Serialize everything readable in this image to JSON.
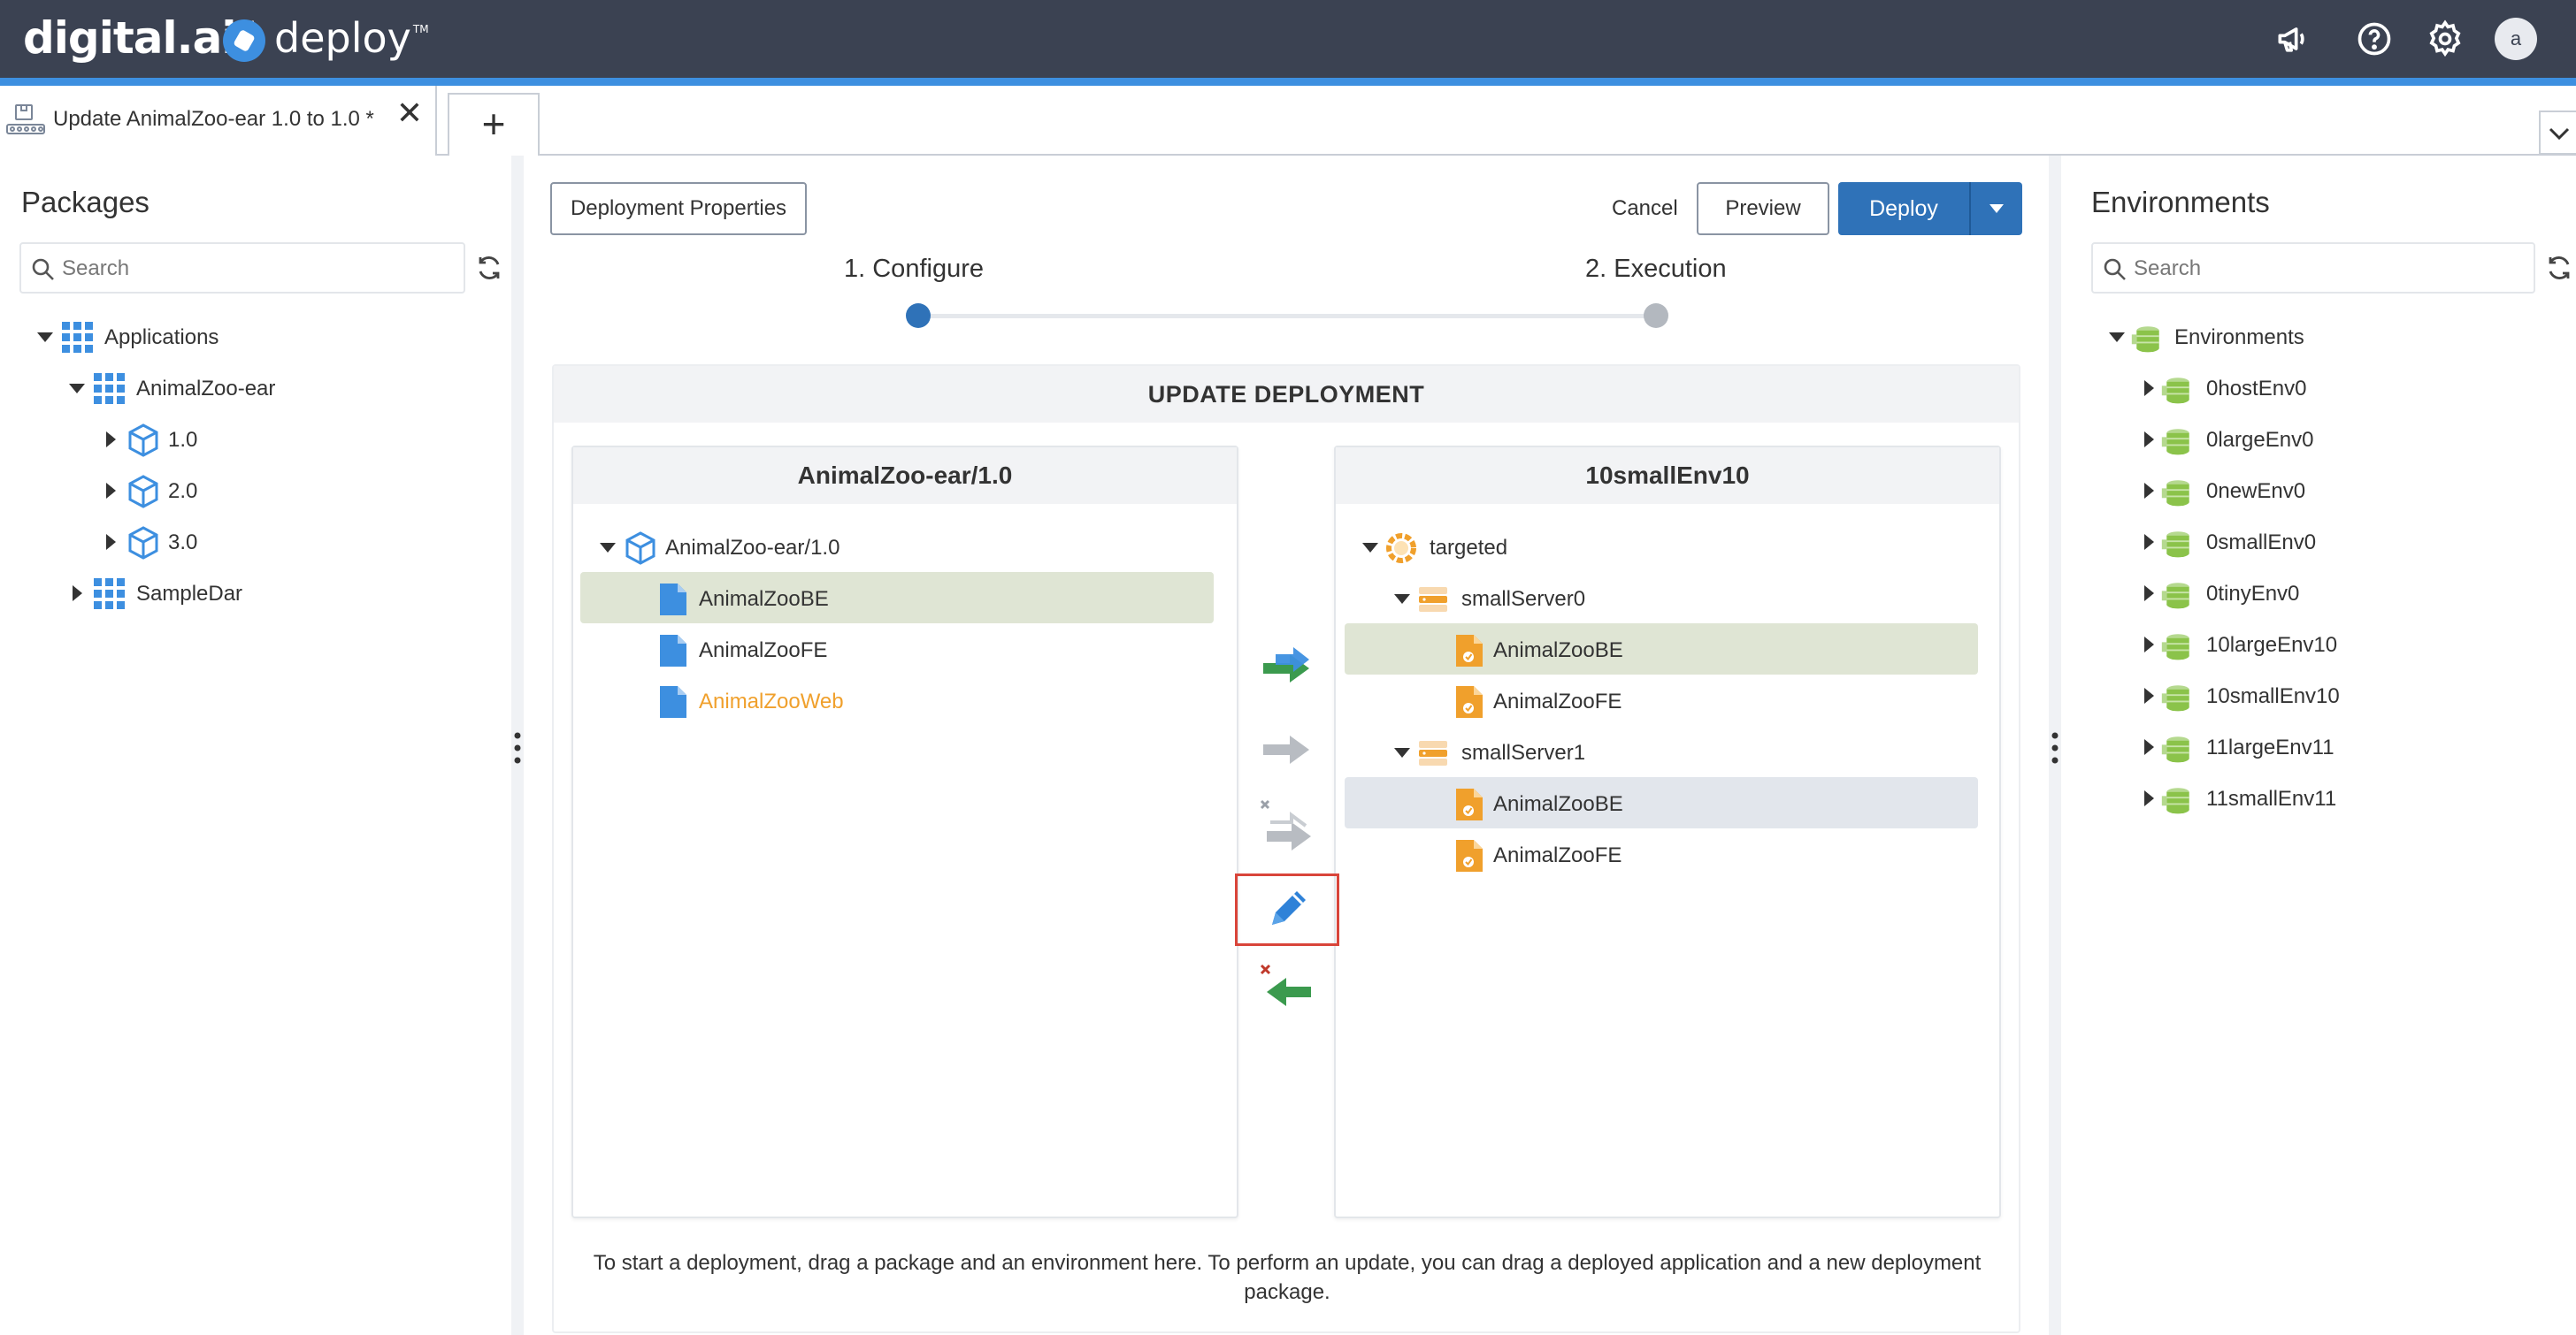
{
  "header": {
    "brand": "digital.ai",
    "brand_mark": "TM",
    "product": "deploy",
    "product_mark": "TM",
    "icons": [
      "megaphone-icon",
      "help-icon",
      "settings-icon"
    ],
    "avatar_initial": "a"
  },
  "tabs": {
    "active_title": "Update AnimalZoo-ear 1.0 to 1.0 *",
    "close_glyph": "✕",
    "add_glyph": "+"
  },
  "packages": {
    "title": "Packages",
    "search_placeholder": "Search",
    "tree": {
      "applications": "Applications",
      "app": "AnimalZoo-ear",
      "versions": [
        "1.0",
        "2.0",
        "3.0"
      ],
      "other": "SampleDar"
    }
  },
  "toolbar": {
    "properties": "Deployment Properties",
    "cancel": "Cancel",
    "preview": "Preview",
    "deploy": "Deploy"
  },
  "steps": {
    "configure": "1. Configure",
    "execution": "2. Execution",
    "active_color": "#2f72b8",
    "inactive_color": "#b3b8bf"
  },
  "deployment": {
    "title": "UPDATE DEPLOYMENT",
    "package_panel": {
      "title": "AnimalZoo-ear/1.0",
      "root": "AnimalZoo-ear/1.0",
      "items": [
        "AnimalZooBE",
        "AnimalZooFE",
        "AnimalZooWeb"
      ]
    },
    "environment_panel": {
      "title": "10smallEnv10",
      "root": "targeted",
      "servers": [
        {
          "name": "smallServer0",
          "items": [
            "AnimalZooBE",
            "AnimalZooFE"
          ]
        },
        {
          "name": "smallServer1",
          "items": [
            "AnimalZooBE",
            "AnimalZooFE"
          ]
        }
      ]
    },
    "actions": [
      "map-selected-icon",
      "map-all-icon",
      "unmap-all-icon",
      "edit-icon",
      "remove-icon"
    ],
    "hint": "To start a deployment, drag a package and an environment here. To perform an update, you can drag a deployed application and a new deployment package."
  },
  "environments": {
    "title": "Environments",
    "search_placeholder": "Search",
    "root": "Environments",
    "items": [
      "0hostEnv0",
      "0largeEnv0",
      "0newEnv0",
      "0smallEnv0",
      "0tinyEnv0",
      "10largeEnv10",
      "10smallEnv10",
      "11largeEnv11",
      "11smallEnv11"
    ]
  },
  "colors": {
    "header_bg": "#3b4252",
    "accent": "#3d8fe0",
    "primary": "#2f72b8",
    "selected_row": "#dfe5d4",
    "selected_row_alt": "#e2e6ec",
    "warning_text": "#f0a02c",
    "env_green": "#8bc34a"
  }
}
